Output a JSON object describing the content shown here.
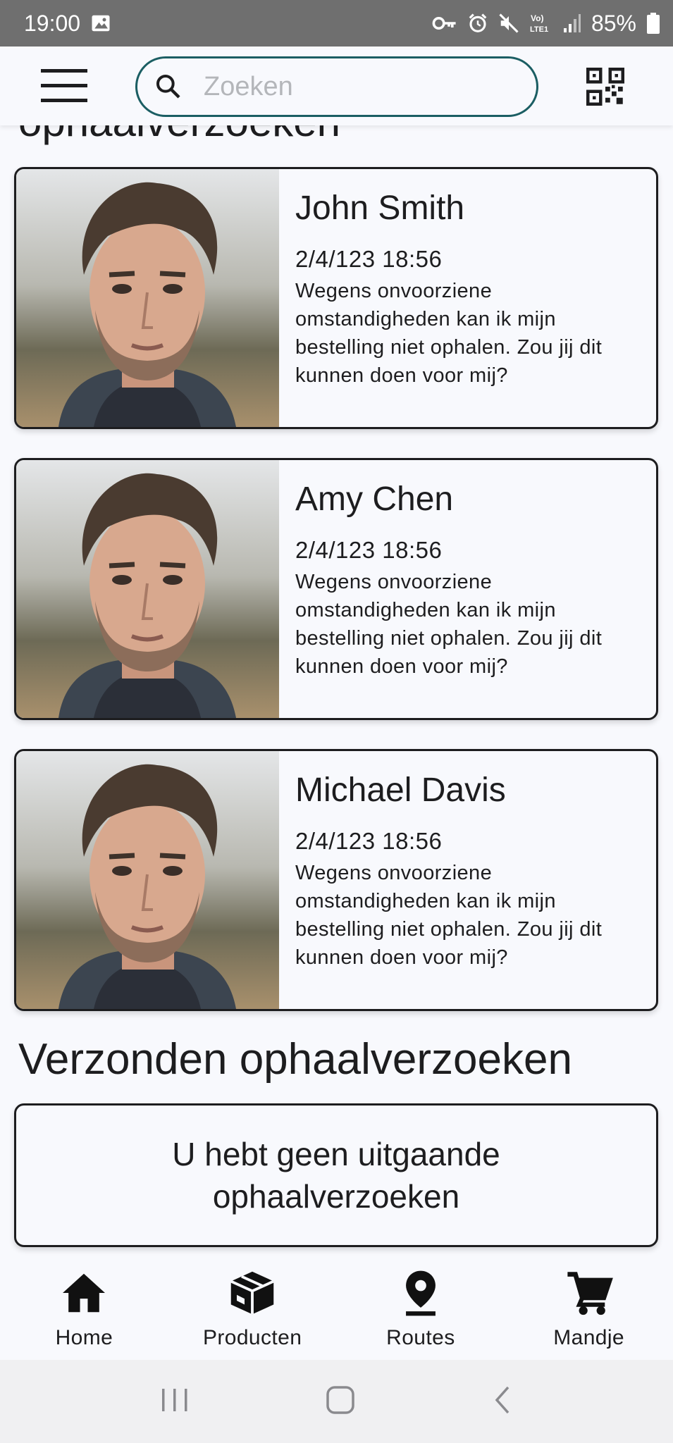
{
  "status_bar": {
    "time": "19:00",
    "battery": "85%",
    "icons": [
      "image-icon",
      "vpn-key-icon",
      "alarm-icon",
      "mute-icon",
      "volte-icon",
      "signal-icon",
      "battery-icon"
    ]
  },
  "top_bar": {
    "search_placeholder": "Zoeken",
    "icons": [
      "menu-icon",
      "search-icon",
      "qr-code-icon"
    ],
    "accent_color": "#1b5e63"
  },
  "incoming": {
    "heading": "ophaalverzoeken",
    "requests": [
      {
        "name": "John Smith",
        "date": "2/4/123 18:56",
        "message": "Wegens onvoorziene omstandigheden kan ik mijn bestelling niet ophalen. Zou jij dit kunnen doen voor mij?"
      },
      {
        "name": "Amy Chen",
        "date": "2/4/123 18:56",
        "message": "Wegens onvoorziene omstandigheden kan ik mijn bestelling niet ophalen. Zou jij dit kunnen doen voor mij?"
      },
      {
        "name": "Michael Davis",
        "date": "2/4/123 18:56",
        "message": "Wegens onvoorziene omstandigheden kan ik mijn bestelling niet ophalen. Zou jij dit kunnen doen voor mij?"
      }
    ]
  },
  "sent": {
    "heading": "Verzonden ophaalverzoeken",
    "empty_message": "U hebt geen uitgaande ophaalverzoeken"
  },
  "bottom_nav": {
    "items": [
      {
        "label": "Home",
        "icon": "home-icon"
      },
      {
        "label": "Producten",
        "icon": "box-icon"
      },
      {
        "label": "Routes",
        "icon": "location-pin-icon"
      },
      {
        "label": "Mandje",
        "icon": "cart-icon"
      }
    ]
  },
  "system_nav": {
    "icons": [
      "recent-apps-icon",
      "home-button-icon",
      "back-icon"
    ]
  }
}
